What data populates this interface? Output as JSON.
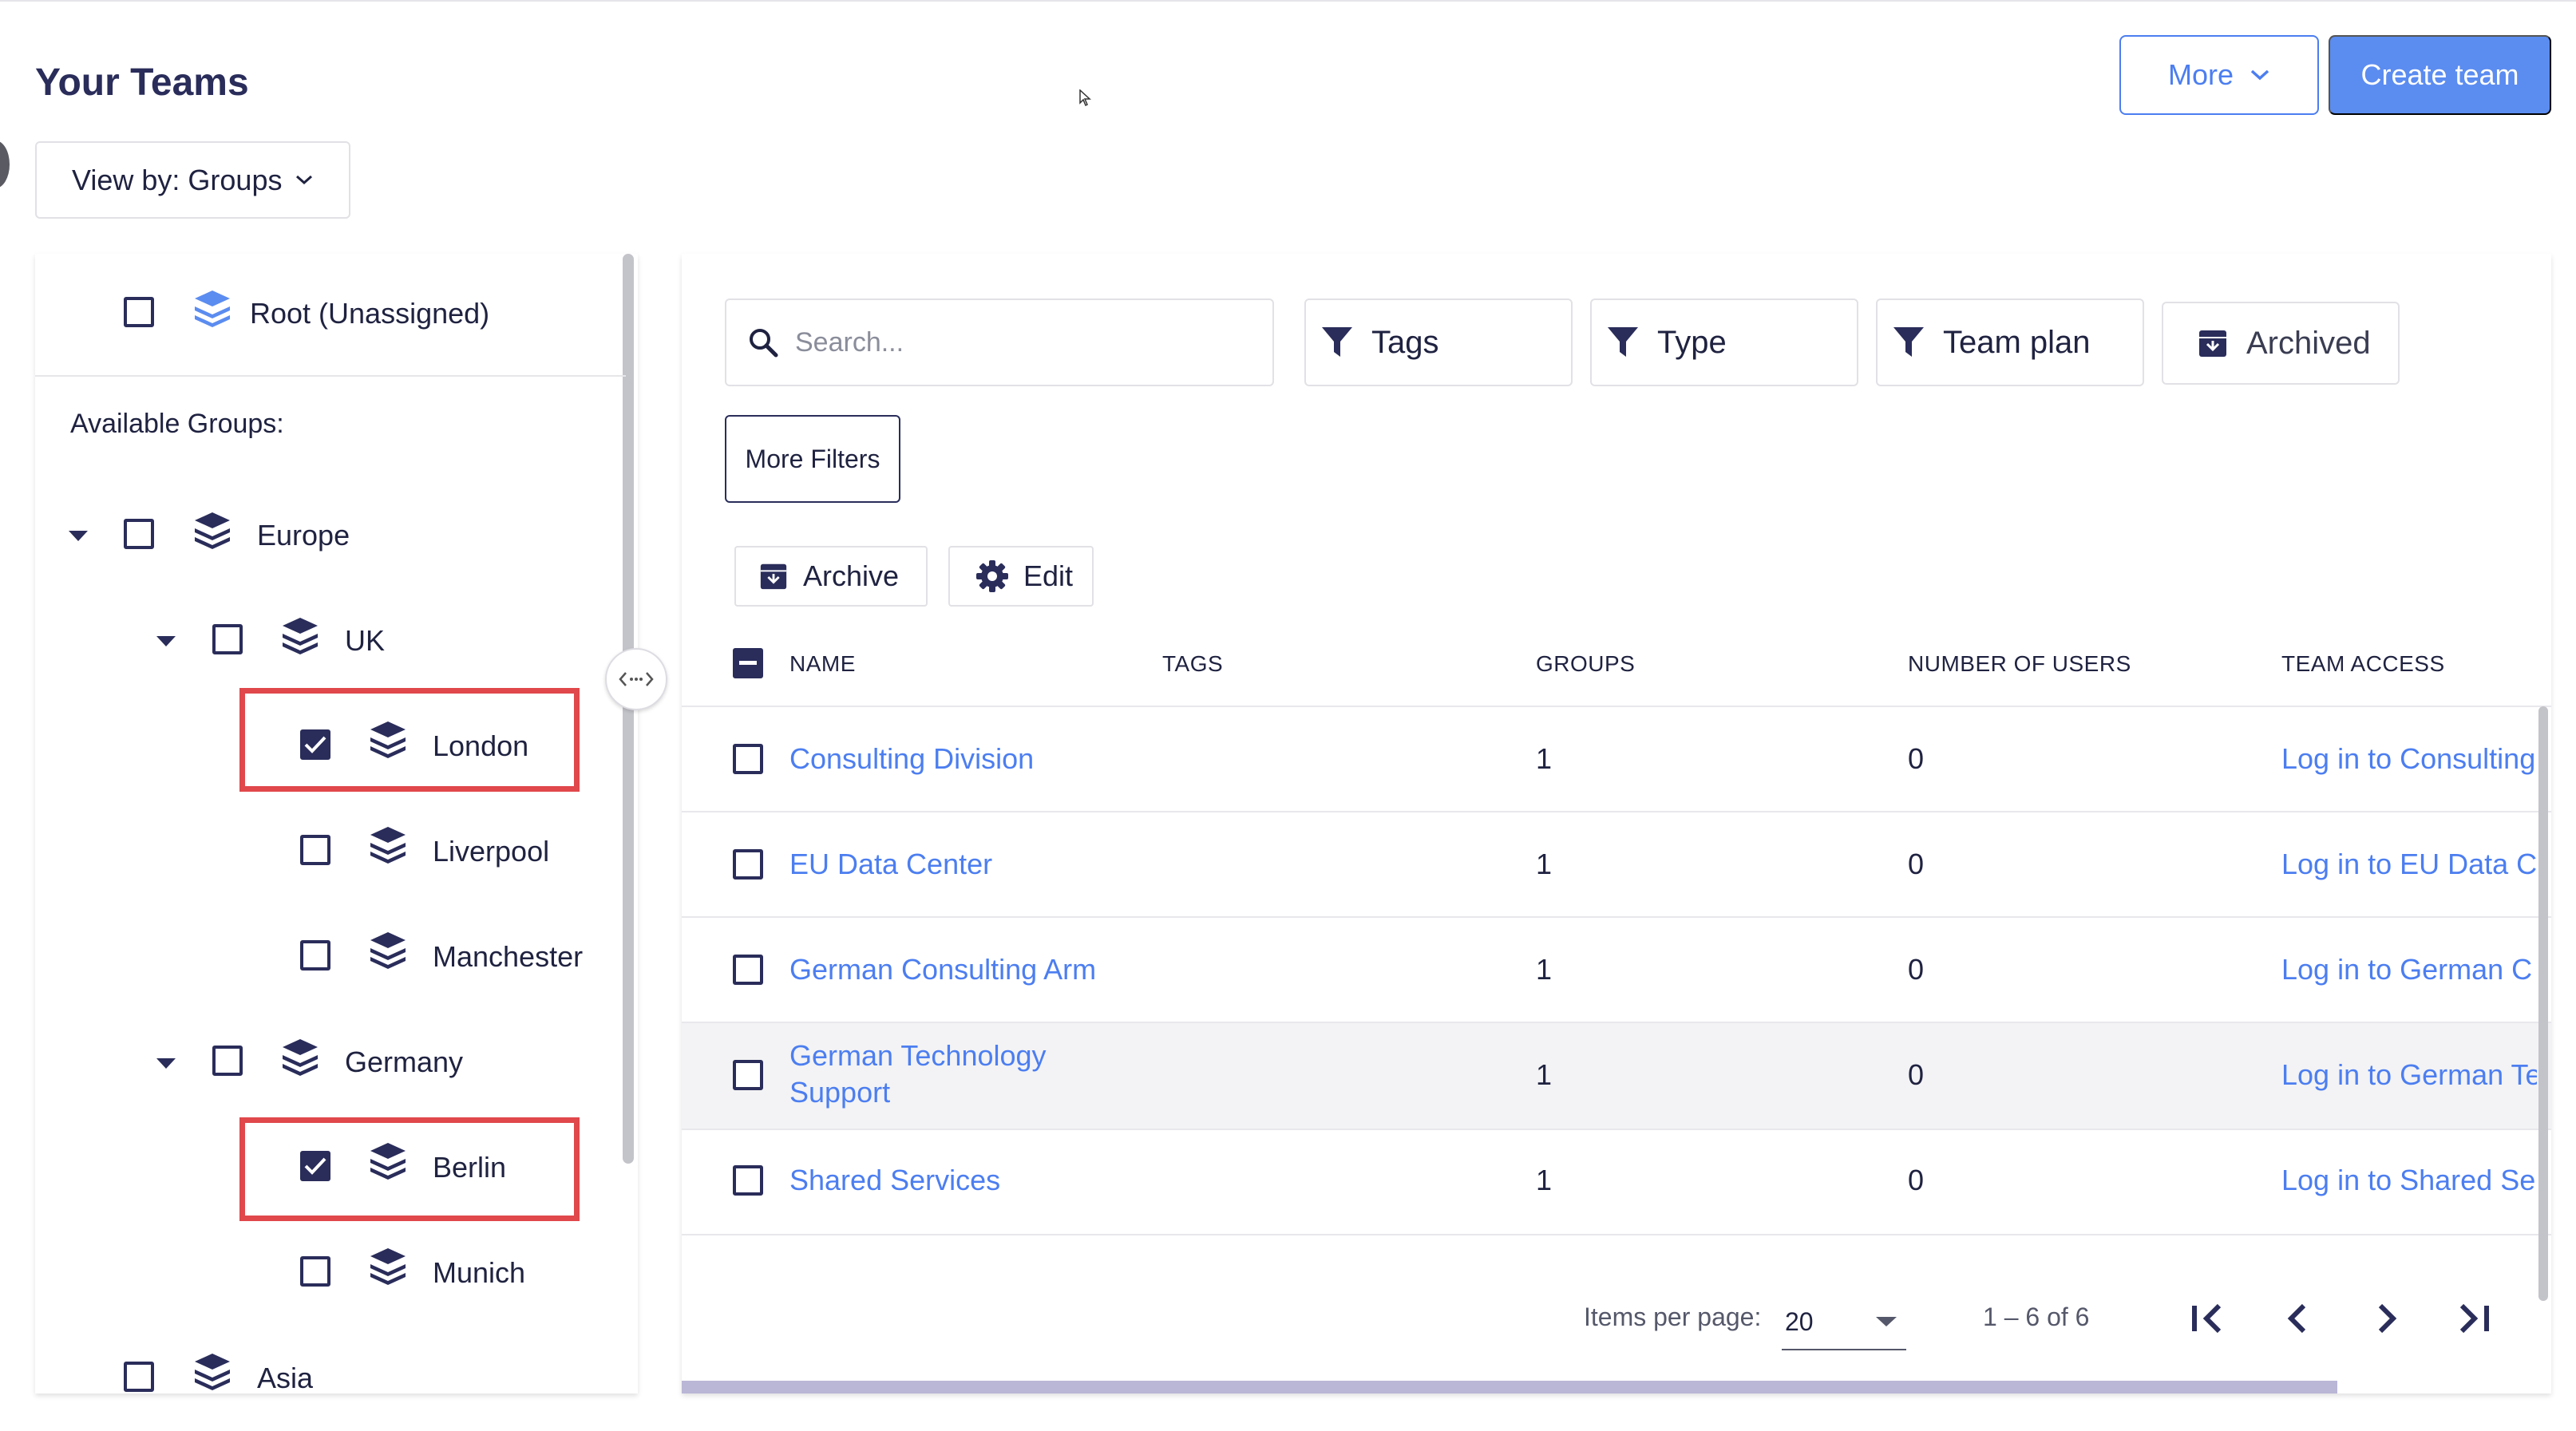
{
  "header": {
    "title": "Your Teams",
    "more_label": "More",
    "create_label": "Create team"
  },
  "view_by": {
    "label": "View by: Groups"
  },
  "groups": {
    "root_label": "Root (Unassigned)",
    "available_label": "Available Groups:",
    "items": [
      {
        "label": "Europe",
        "checked": false,
        "expanded": true,
        "highlighted": false
      },
      {
        "label": "UK",
        "checked": false,
        "expanded": true,
        "highlighted": false
      },
      {
        "label": "London",
        "checked": true,
        "highlighted": true
      },
      {
        "label": "Liverpool",
        "checked": false,
        "highlighted": false
      },
      {
        "label": "Manchester",
        "checked": false,
        "highlighted": false
      },
      {
        "label": "Germany",
        "checked": false,
        "expanded": true,
        "highlighted": false
      },
      {
        "label": "Berlin",
        "checked": true,
        "highlighted": true
      },
      {
        "label": "Munich",
        "checked": false,
        "highlighted": false
      },
      {
        "label": "Asia",
        "checked": false,
        "highlighted": false
      }
    ]
  },
  "filters": {
    "search_placeholder": "Search...",
    "tags": "Tags",
    "type": "Type",
    "team_plan": "Team plan",
    "archived": "Archived",
    "more_filters": "More Filters"
  },
  "actions": {
    "archive": "Archive",
    "edit": "Edit"
  },
  "table": {
    "columns": [
      "NAME",
      "TAGS",
      "GROUPS",
      "NUMBER OF USERS",
      "TEAM ACCESS"
    ],
    "rows": [
      {
        "name": "Consulting Division",
        "groups": "1",
        "users": "0",
        "access": "Log in to Consulting"
      },
      {
        "name": "EU Data Center",
        "groups": "1",
        "users": "0",
        "access": "Log in to EU Data C"
      },
      {
        "name": "German Consulting Arm",
        "groups": "1",
        "users": "0",
        "access": "Log in to German C"
      },
      {
        "name_line1": "German Technology",
        "name_line2": "Support",
        "groups": "1",
        "users": "0",
        "access": "Log in to German Te"
      },
      {
        "name": "Shared Services",
        "groups": "1",
        "users": "0",
        "access": "Log in to Shared Ser"
      }
    ]
  },
  "pagination": {
    "items_per_page_label": "Items per page:",
    "items_per_page": "20",
    "range": "1 – 6 of 6"
  },
  "colors": {
    "accent": "#4c7ef0",
    "navy": "#2a2d5a",
    "highlight": "#e0484b"
  }
}
